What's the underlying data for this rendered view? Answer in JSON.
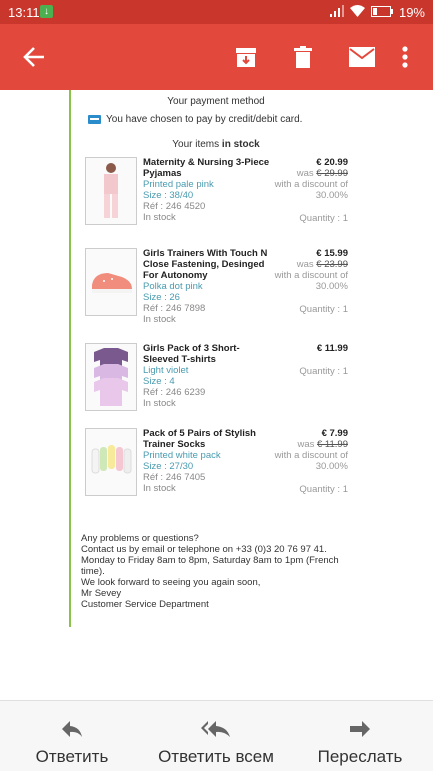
{
  "status_bar": {
    "time": "13:11",
    "battery": "19%"
  },
  "toolbar": {
    "back": "back-arrow",
    "archive": "archive-icon",
    "delete": "trash-icon",
    "mail": "mail-icon",
    "more": "more-vert-icon"
  },
  "email": {
    "payment_heading": "Your payment method",
    "payment_text": "You have chosen to pay by credit/debit card.",
    "items_heading_prefix": "Your items",
    "items_heading_bold": "in stock",
    "items": [
      {
        "name": "Maternity & Nursing 3-Piece Pyjamas",
        "color": "Printed pale pink",
        "size": "Size : 38/40",
        "ref": "Réf : 246 4520",
        "stock": "In stock",
        "price": "€ 20.99",
        "was_label": "was",
        "was_price": "€ 29.99",
        "discount": "with a discount of 30.00%",
        "quantity": "Quantity : 1"
      },
      {
        "name": "Girls Trainers With Touch N Close Fastening, Desinged For Autonomy",
        "color": "Polka dot pink",
        "size": "Size : 26",
        "ref": "Réf : 246 7898",
        "stock": "In stock",
        "price": "€ 15.99",
        "was_label": "was",
        "was_price": "€ 23.99",
        "discount": "with a discount of 30.00%",
        "quantity": "Quantity : 1"
      },
      {
        "name": "Girls Pack of 3 Short-Sleeved T-shirts",
        "color": "Light violet",
        "size": "Size : 4",
        "ref": "Réf : 246 6239",
        "stock": "In stock",
        "price": "€ 11.99",
        "quantity": "Quantity : 1"
      },
      {
        "name": "Pack of 5 Pairs of Stylish Trainer Socks",
        "color": "Printed white pack",
        "size": "Size : 27/30",
        "ref": "Réf : 246 7405",
        "stock": "In stock",
        "price": "€ 7.99",
        "was_label": "was",
        "was_price": "€ 11.99",
        "discount": "with a discount of 30.00%",
        "quantity": "Quantity : 1"
      }
    ],
    "footer": [
      "Any problems or questions?",
      "Contact us by email or telephone on +33 (0)3 20 76 97 41.",
      "Monday to Friday 8am to 8pm, Saturday 8am to 1pm (French time).",
      "We look forward to seeing you again soon,",
      "Mr Sevey",
      "Customer Service Department"
    ]
  },
  "bottom_bar": {
    "reply": "Ответить",
    "reply_all": "Ответить всем",
    "forward": "Переслать"
  }
}
